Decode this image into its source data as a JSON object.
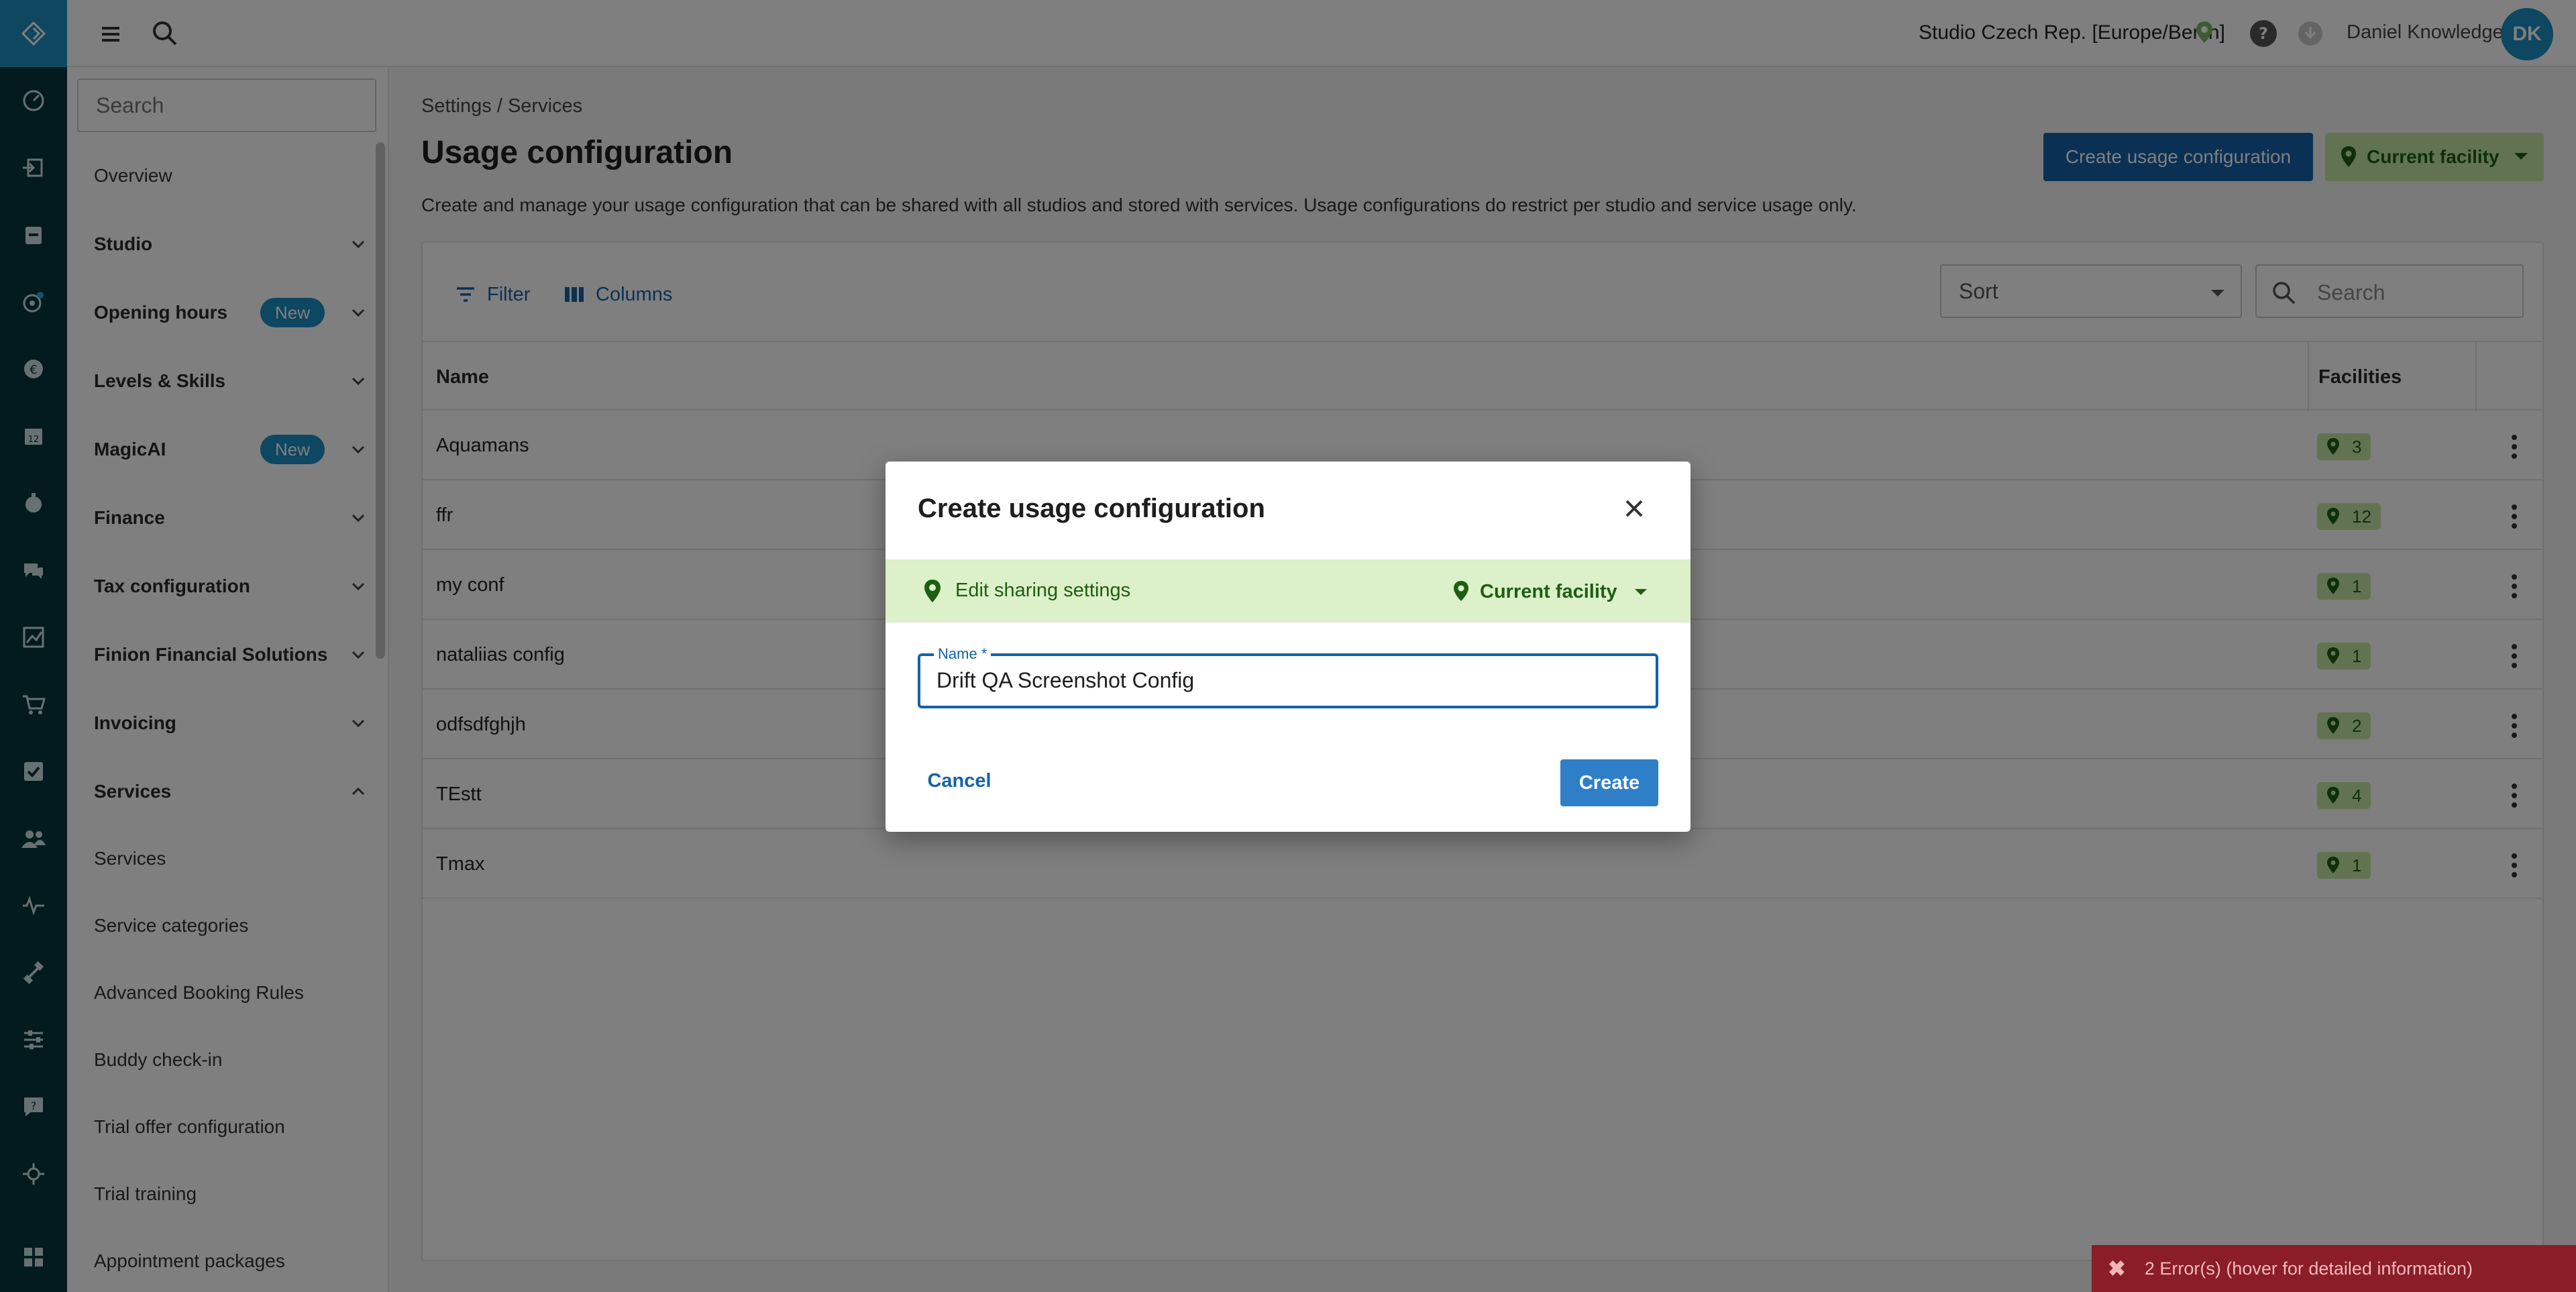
{
  "topbar": {
    "facility": "Studio Czech Rep. [Europe/Berlin]",
    "user_name": "Daniel Knowledge",
    "avatar_initials": "DK"
  },
  "sidebar": {
    "search_placeholder": "Search",
    "items": [
      {
        "label": "Overview"
      },
      {
        "label": "Studio"
      },
      {
        "label": "Opening hours",
        "badge": "New"
      },
      {
        "label": "Levels & Skills"
      },
      {
        "label": "MagicAI",
        "badge": "New"
      },
      {
        "label": "Finance"
      },
      {
        "label": "Tax configuration"
      },
      {
        "label": "Finion Financial Solutions"
      },
      {
        "label": "Invoicing"
      },
      {
        "label": "Services"
      },
      {
        "label": "Services"
      },
      {
        "label": "Service categories"
      },
      {
        "label": "Advanced Booking Rules"
      },
      {
        "label": "Buddy check-in"
      },
      {
        "label": "Trial offer configuration"
      },
      {
        "label": "Trial training"
      },
      {
        "label": "Appointment packages"
      }
    ]
  },
  "page": {
    "breadcrumb": "Settings  /  Services",
    "title": "Usage configuration",
    "description": "Create and manage your usage configuration that can be shared with all studios and stored with services. Usage configurations do restrict per studio and service usage only.",
    "create_button": "Create usage configuration",
    "facility_button": "Current facility"
  },
  "table": {
    "filter_label": "Filter",
    "columns_label": "Columns",
    "sort_placeholder": "Sort",
    "search_placeholder": "Search",
    "headers": {
      "name": "Name",
      "facilities": "Facilities"
    },
    "rows": [
      {
        "name": "Aquamans",
        "facilities": "3"
      },
      {
        "name": "ffr",
        "facilities": "12"
      },
      {
        "name": "my conf",
        "facilities": "1"
      },
      {
        "name": "nataliias config",
        "facilities": "1"
      },
      {
        "name": "odfsdfghjh",
        "facilities": "2"
      },
      {
        "name": "TEstt",
        "facilities": "4"
      },
      {
        "name": "Tmax",
        "facilities": "1"
      }
    ]
  },
  "modal": {
    "title": "Create usage configuration",
    "sharing_label": "Edit sharing settings",
    "sharing_facility": "Current facility",
    "name_label": "Name *",
    "name_value": "Drift QA Screenshot Config",
    "cancel": "Cancel",
    "create": "Create"
  },
  "error_bar": {
    "message": "2 Error(s) (hover for detailed information)"
  },
  "colors": {
    "rail": "#06373f",
    "accent": "#1462a8",
    "facility_green": "#c4e6a5",
    "error": "#8a1d27"
  }
}
